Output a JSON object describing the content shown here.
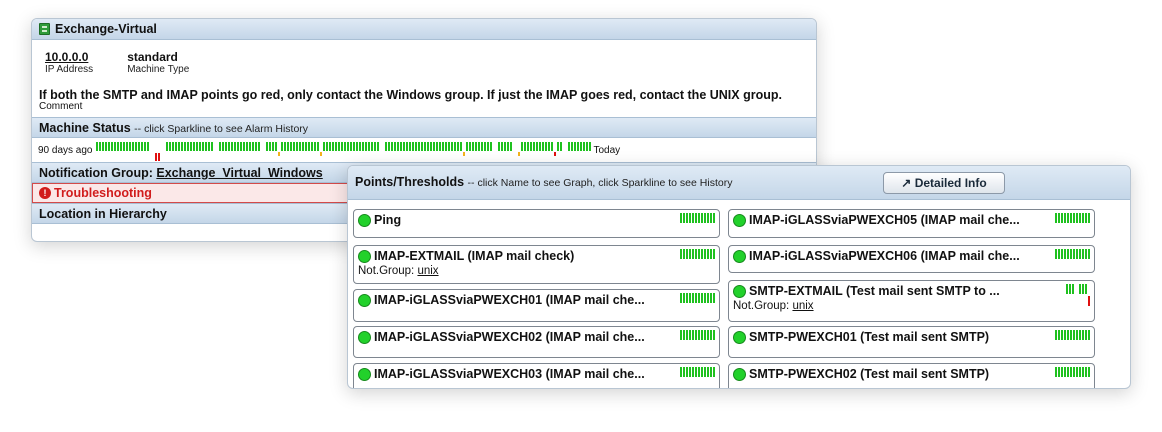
{
  "machine": {
    "title": "Exchange-Virtual",
    "ip_value": "10.0.0.0",
    "ip_label": "IP Address",
    "type_value": "standard",
    "type_label": "Machine Type",
    "comment_text": "If both the SMTP and IMAP points go red, only contact the Windows group. If just the IMAP goes red, contact the UNIX group.",
    "comment_label": "Comment",
    "status_title": "Machine Status",
    "status_hint": "-- click Sparkline to see Alarm History",
    "status_start": "90 days ago",
    "status_end": "Today",
    "notification_label": "Notification Group:",
    "notification_group": "Exchange_Virtual_Windows",
    "troubleshooting": "Troubleshooting",
    "location": "Location in Hierarchy"
  },
  "points": {
    "title": "Points/Thresholds",
    "hint": "-- click Name to see Graph, click Sparkline to see History",
    "detail_button": "Detailed Info",
    "left": [
      {
        "name": "Ping"
      },
      {
        "name": "IMAP-EXTMAIL (IMAP mail check)",
        "group_label": "Not.Group:",
        "group": "unix"
      },
      {
        "name": "IMAP-iGLASSviaPWEXCH01 (IMAP mail che..."
      },
      {
        "name": "IMAP-iGLASSviaPWEXCH02 (IMAP mail che..."
      },
      {
        "name": "IMAP-iGLASSviaPWEXCH03 (IMAP mail che..."
      }
    ],
    "right": [
      {
        "name": "IMAP-iGLASSviaPWEXCH05 (IMAP mail che..."
      },
      {
        "name": "IMAP-iGLASSviaPWEXCH06 (IMAP mail che..."
      },
      {
        "name": "SMTP-EXTMAIL (Test mail sent SMTP to ...",
        "group_label": "Not.Group:",
        "group": "unix",
        "alarm": true
      },
      {
        "name": "SMTP-PWEXCH01 (Test mail sent SMTP)"
      },
      {
        "name": "SMTP-PWEXCH02 (Test mail sent SMTP)"
      }
    ]
  }
}
